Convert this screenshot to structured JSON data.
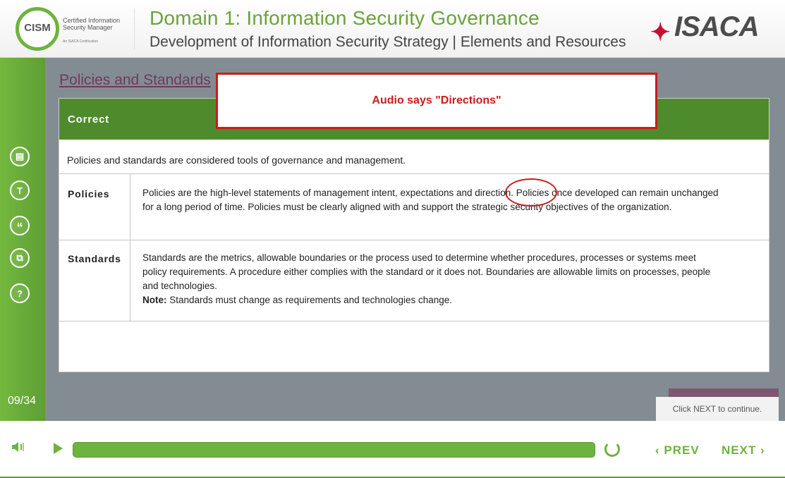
{
  "header": {
    "logo_text": "CISM",
    "cert_line1": "Certified Information",
    "cert_line2": "Security Manager",
    "cert_sub": "An ISACA Certification",
    "title": "Domain 1: Information Security Governance",
    "subtitle": "Development of Information Security Strategy | Elements and Resources",
    "brand": "ISACA"
  },
  "sidebar": {
    "items": [
      {
        "icon": "notes-icon",
        "glyph": "▤"
      },
      {
        "icon": "transcript-icon",
        "glyph": "T"
      },
      {
        "icon": "quote-icon",
        "glyph": "“"
      },
      {
        "icon": "layers-icon",
        "glyph": "⧉"
      },
      {
        "icon": "help-icon",
        "glyph": "?"
      }
    ],
    "slide_counter": "09/34"
  },
  "main": {
    "slide_title": "Policies and Standards",
    "panel_header": "Correct",
    "intro": "Policies and standards are considered tools of governance and management.",
    "rows": [
      {
        "term": "Policies",
        "definition": "Policies are the high-level statements of management intent, expectations and direction. Policies once developed can remain unchanged for a long period of time. Policies must be clearly aligned with and support the strategic security objectives of the organization."
      },
      {
        "term": "Standards",
        "definition": "Standards are the metrics, allowable boundaries or the process used to determine whether procedures, processes or systems meet policy requirements. A procedure either complies with the standard or it does not. Boundaries are allowable limits on processes, people and technologies.",
        "note_label": "Note:",
        "note": " Standards must change as requirements and technologies change."
      }
    ],
    "audio_note": "Audio says \"Directions\"",
    "next_hint": "Click NEXT to continue."
  },
  "controls": {
    "prev_label": "‹ PREV",
    "next_label": "NEXT ›",
    "progress_percent": 100,
    "accent_color": "#6db33f"
  }
}
